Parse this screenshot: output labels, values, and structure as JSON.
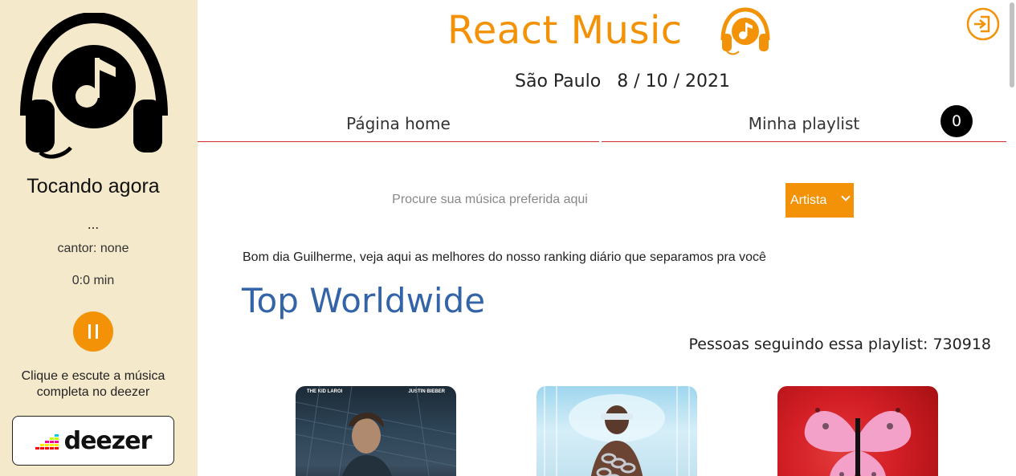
{
  "sidebar": {
    "logo_icon": "headphones-music-icon",
    "now_playing_label": "Tocando agora",
    "track_title": "...",
    "singer": "cantor: none",
    "duration": "0:0 min",
    "pause_icon": "pause-icon",
    "listen_text": "Clique e escute a música completa no deezer",
    "deezer_label": "deezer"
  },
  "header": {
    "title": "React Music",
    "title_icon": "headphones-music-icon",
    "logout_icon": "logout-icon",
    "city": "São Paulo",
    "date": "8 / 10 / 2021"
  },
  "nav": {
    "home": "Página home",
    "playlist": "Minha playlist",
    "playlist_count": "0"
  },
  "search": {
    "placeholder": "Procure sua música preferida aqui",
    "filter_value": "Artista"
  },
  "main": {
    "greeting": "Bom dia Guilherme, veja aqui as melhores do nosso ranking diário que separamos pra você",
    "playlist_title": "Top Worldwide",
    "followers": "Pessoas seguindo essa playlist: 730918",
    "albums": [
      {
        "artist_left": "THE KID LAROI",
        "artist_right": "JUSTIN BIEBER"
      },
      {
        "artist_left": "",
        "artist_right": ""
      },
      {
        "artist_left": "",
        "artist_right": ""
      }
    ]
  },
  "colors": {
    "accent": "#f39207",
    "sidebar_bg": "#f5e9cb",
    "heading_blue": "#3464a8",
    "nav_underline": "#d12a2a"
  }
}
